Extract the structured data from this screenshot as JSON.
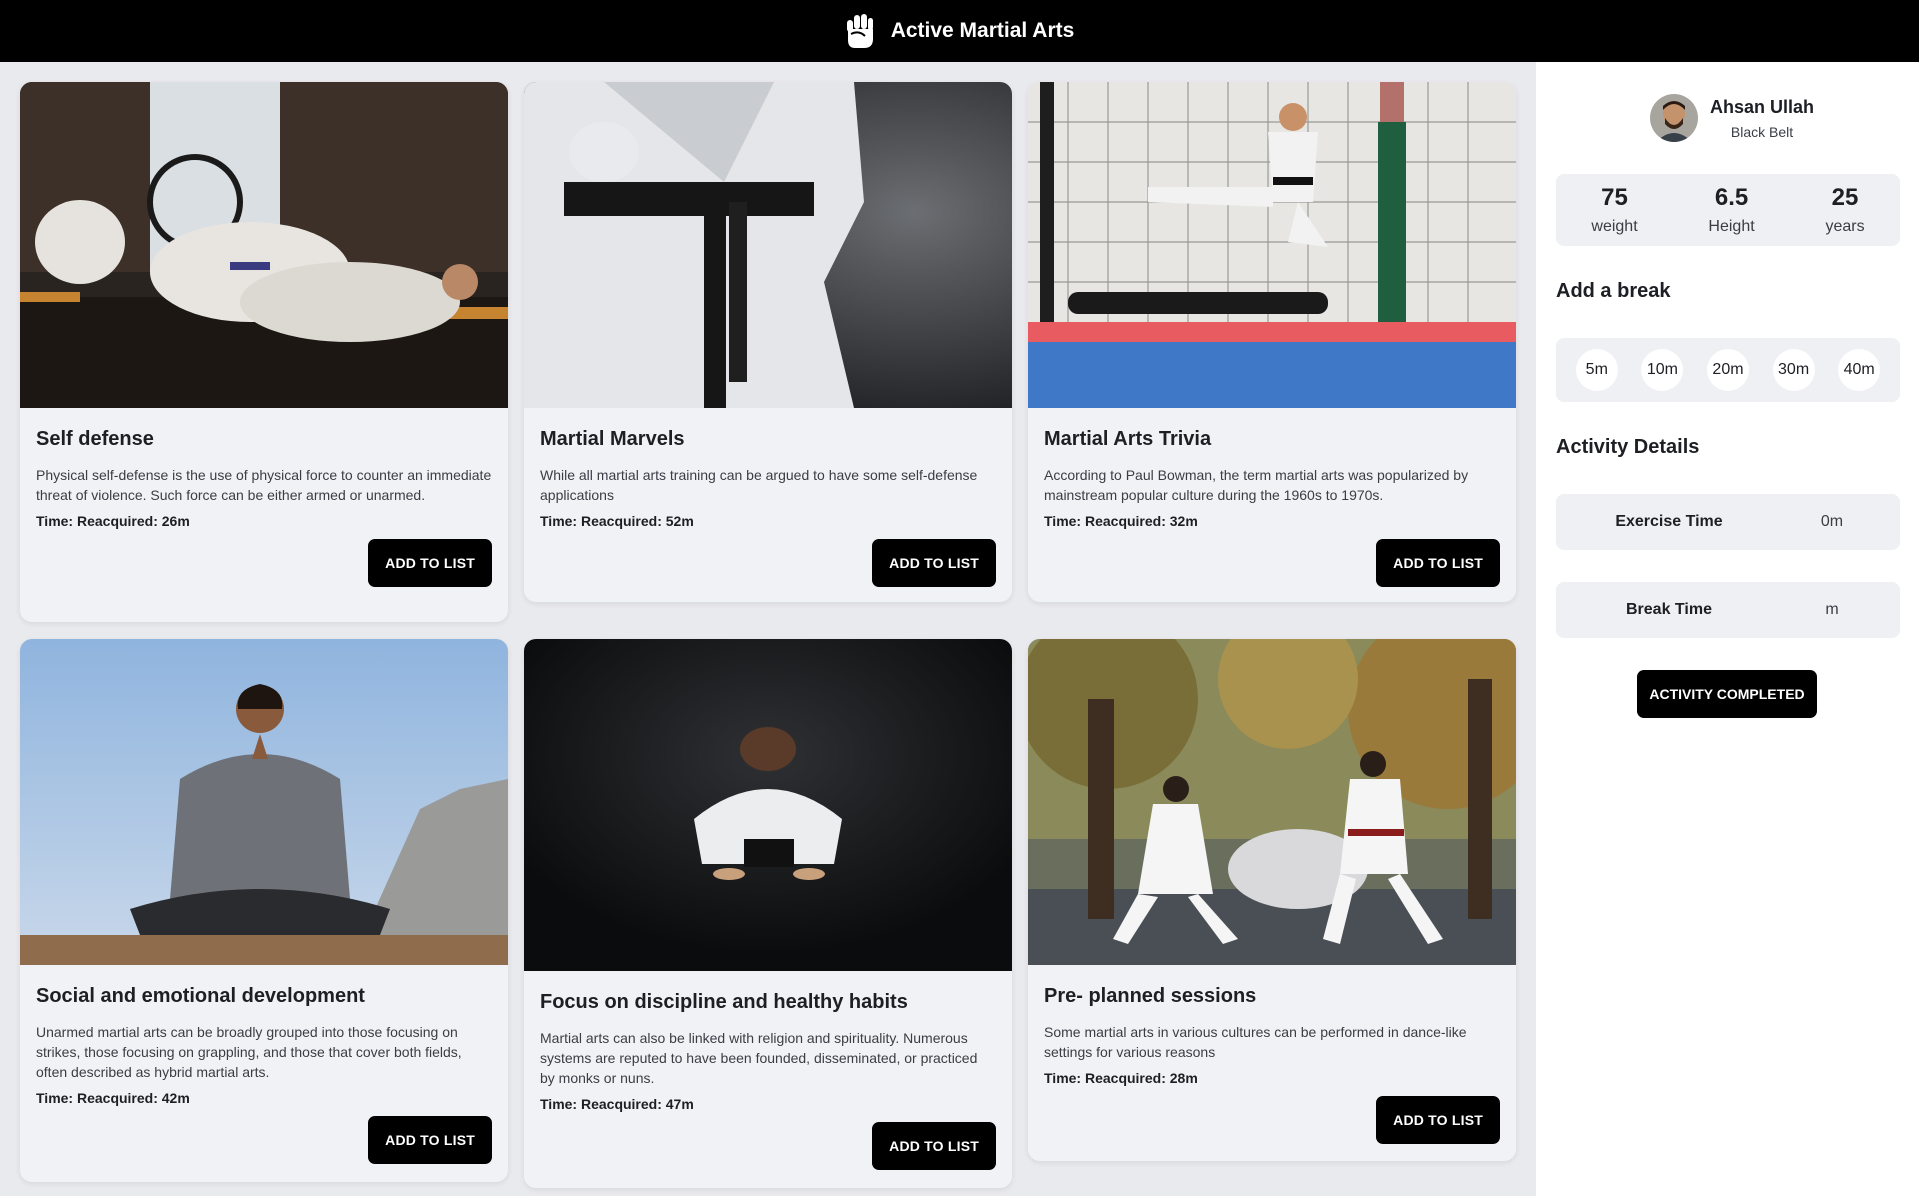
{
  "header": {
    "title": "Active Martial Arts",
    "logo_icon": "fist-icon"
  },
  "cards": [
    {
      "title": "Self defense",
      "description": "Physical self-defense is the use of physical force to counter an immediate threat of violence. Such force can be either armed or unarmed.",
      "time": "Time: Reacquired: 26m",
      "button": "ADD TO LIST"
    },
    {
      "title": "Martial Marvels",
      "description": "While all martial arts training can be argued to have some self-defense applications",
      "time": "Time: Reacquired: 52m",
      "button": "ADD TO LIST"
    },
    {
      "title": "Martial Arts Trivia",
      "description": "According to Paul Bowman, the term martial arts was popularized by mainstream popular culture during the 1960s to 1970s.",
      "time": "Time: Reacquired: 32m",
      "button": "ADD TO LIST"
    },
    {
      "title": "Social and emotional development",
      "description": "Unarmed martial arts can be broadly grouped into those focusing on strikes, those focusing on grappling, and those that cover both fields, often described as hybrid martial arts.",
      "time": "Time: Reacquired: 42m",
      "button": "ADD TO LIST"
    },
    {
      "title": "Focus on discipline and healthy habits",
      "description": "Martial arts can also be linked with religion and spirituality. Numerous systems are reputed to have been founded, disseminated, or practiced by monks or nuns.",
      "time": "Time: Reacquired: 47m",
      "button": "ADD TO LIST"
    },
    {
      "title": "Pre- planned sessions",
      "description": "Some martial arts in various cultures can be performed in dance-like settings for various reasons",
      "time": "Time: Reacquired: 28m",
      "button": "ADD TO LIST"
    }
  ],
  "profile": {
    "name": "Ahsan Ullah",
    "rank": "Black Belt"
  },
  "stats": [
    {
      "value": "75",
      "label": "weight"
    },
    {
      "value": "6.5",
      "label": "Height"
    },
    {
      "value": "25",
      "label": "years"
    }
  ],
  "breaks": {
    "title": "Add a break",
    "options": [
      "5m",
      "10m",
      "20m",
      "30m",
      "40m"
    ]
  },
  "activity": {
    "title": "Activity Details",
    "exercise_label": "Exercise Time",
    "exercise_value": "0m",
    "break_label": "Break Time",
    "break_value": "m",
    "complete_button": "ACTIVITY COMPLETED"
  },
  "colors": {
    "topbar": "#000000",
    "button": "#000000",
    "card_bg": "#f1f2f6",
    "page_bg": "#e9eaee"
  }
}
